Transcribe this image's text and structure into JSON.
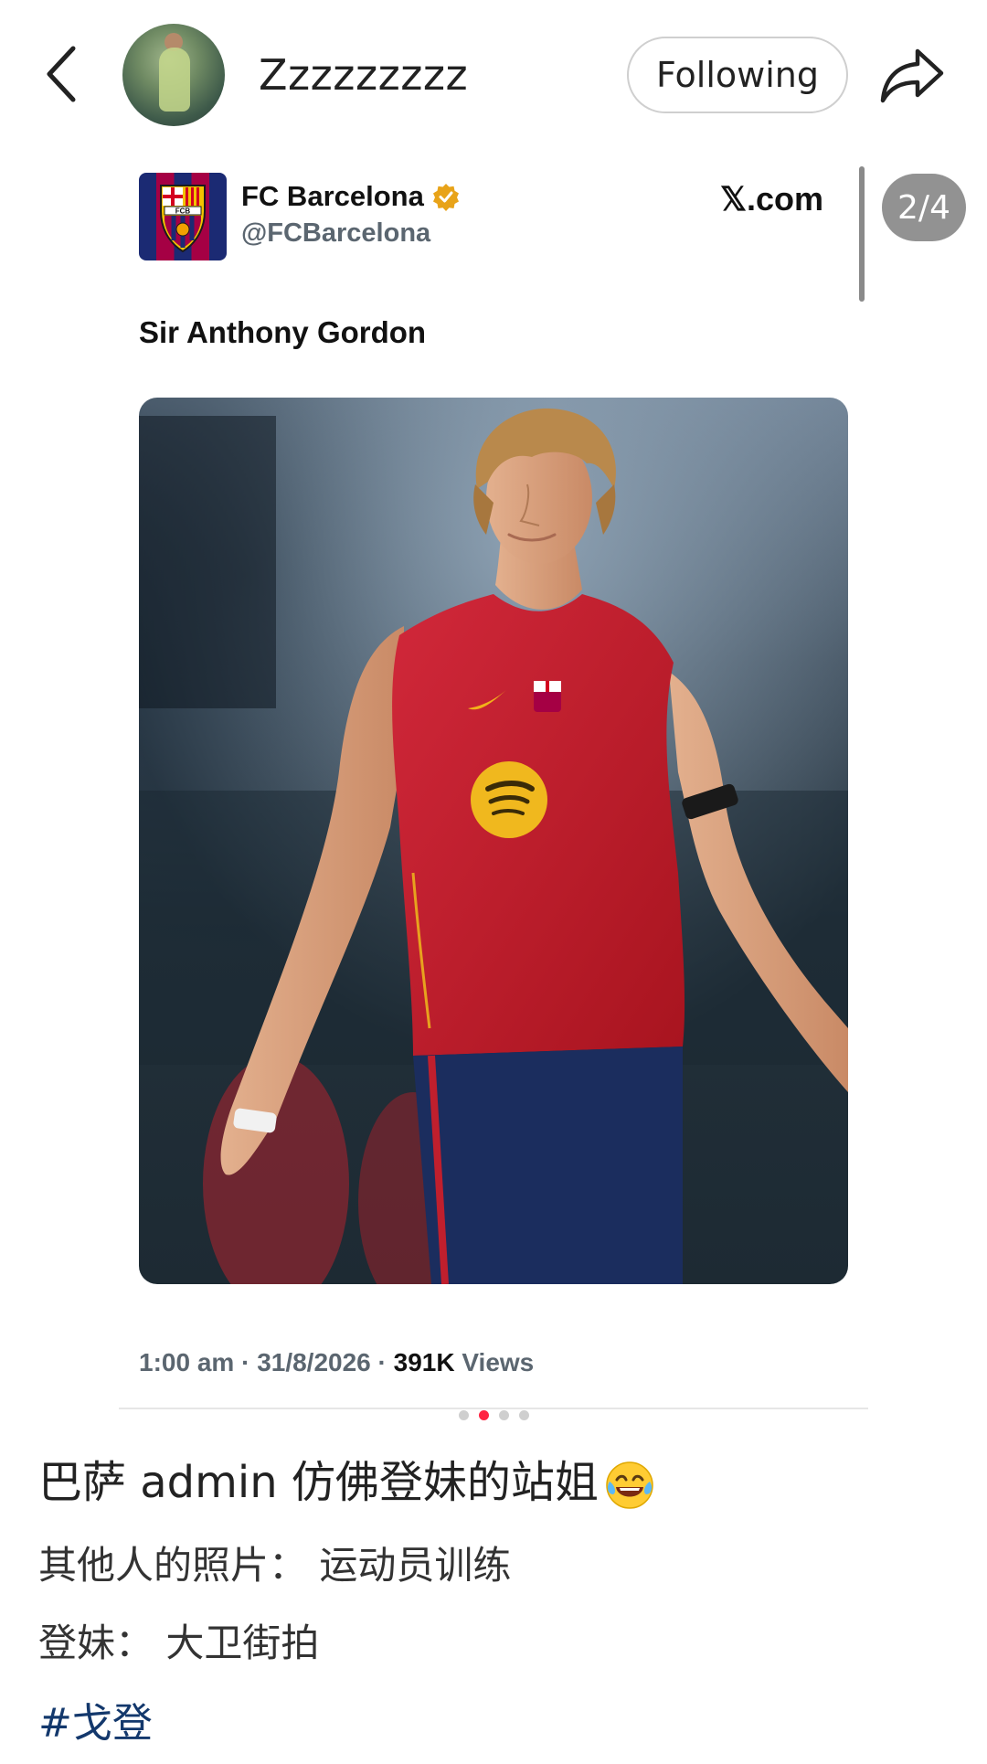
{
  "header": {
    "username": "Zzzzzzzzz",
    "follow_label": "Following",
    "page_counter": "2/4"
  },
  "tweet": {
    "display_name": "FC Barcelona",
    "handle": "@FCBarcelona",
    "source": "𝕏.com",
    "text": "Sir Anthony Gordon",
    "time": "1:00 am",
    "date": "31/8/2026",
    "views_count": "391K",
    "views_label": "Views",
    "separator": " · "
  },
  "carousel": {
    "total": 4,
    "active_index": 1
  },
  "post": {
    "title": "巴萨 admin 仿佛登妹的站姐",
    "line1": "其他人的照片： 运动员训练",
    "line2": "登妹： 大卫街拍",
    "hashtag": "#戈登"
  },
  "colors": {
    "accent_dot": "#ff2442",
    "hashtag": "#13386c",
    "verified_badge": "#e8a319",
    "jersey_red": "#c01f2d",
    "shorts_blue": "#1b2d5e"
  },
  "icons": {
    "back": "back-chevron-icon",
    "share": "share-arrow-icon",
    "verified": "verified-badge-icon",
    "emoji": "laughing-tears-emoji"
  }
}
